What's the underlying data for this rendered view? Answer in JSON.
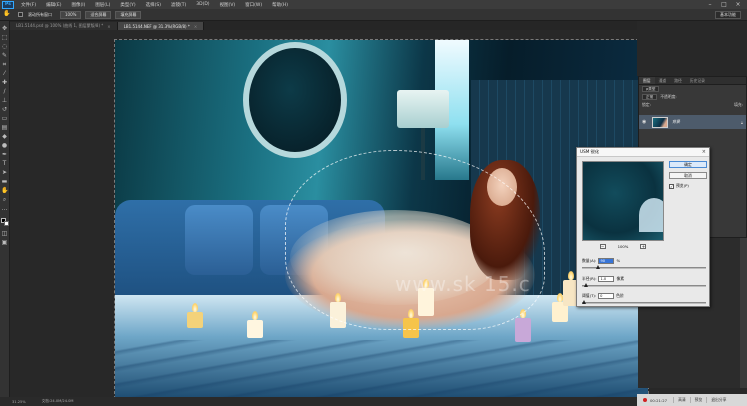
{
  "menubar": {
    "logo": "Ps",
    "items": [
      "文件(F)",
      "编辑(E)",
      "图像(I)",
      "图层(L)",
      "类型(Y)",
      "选择(S)",
      "滤镜(T)",
      "3D(D)",
      "视图(V)",
      "窗口(W)",
      "帮助(H)"
    ],
    "controls": [
      "–",
      "□",
      "×"
    ]
  },
  "optionsbar": {
    "buttons": [
      "滚动所有窗口",
      "100%",
      "适合屏幕",
      "填充屏幕"
    ],
    "workspace": "基本功能"
  },
  "tabs": [
    {
      "label": "LB1.5144.psd @ 100% (曲线 1, 图层蒙版/8) *",
      "active": false
    },
    {
      "label": "LB1.5144.NEF @ 31.3%(RGB/8) *",
      "active": true
    }
  ],
  "canvas": {
    "watermark": "www.sk 15.c"
  },
  "status": {
    "zoom": "31.25%",
    "doc": "文档:24.0M/24.0M"
  },
  "layers": {
    "tabs": [
      "图层",
      "通道",
      "路径",
      "历史记录"
    ],
    "kind_label": "ρ类型",
    "blend_mode": "正常",
    "opacity_label": "不透明度:",
    "lock_label": "锁定:",
    "fill_label": "填充:",
    "layer_name": "背景"
  },
  "recorder": {
    "time": "00:21:27",
    "buttons": [
      "高清",
      "预览",
      "退出分享"
    ]
  },
  "usm": {
    "title": "USM 锐化",
    "ok": "确定",
    "cancel": "取消",
    "preview_label": "预览(P)",
    "zoom_level": "100%",
    "zoom_out": "−",
    "zoom_in": "+",
    "amount_label": "数量(A):",
    "amount_value": "90",
    "amount_unit": "%",
    "radius_label": "半径(R):",
    "radius_value": "1.0",
    "radius_unit": "像素",
    "threshold_label": "阈值(T):",
    "threshold_value": "0",
    "threshold_unit": "色阶",
    "amount_fraction": 0.12,
    "radius_fraction": 0.02,
    "threshold_fraction": 0.0
  }
}
